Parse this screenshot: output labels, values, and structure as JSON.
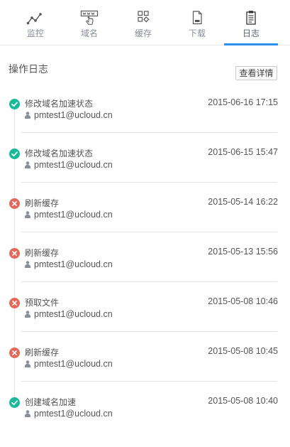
{
  "tabs": [
    {
      "key": "monitor",
      "label": "监控",
      "icon": "line-chart-icon"
    },
    {
      "key": "domain",
      "label": "域名",
      "icon": "www-domain-icon"
    },
    {
      "key": "cache",
      "label": "缓存",
      "icon": "cache-grid-icon"
    },
    {
      "key": "download",
      "label": "下载",
      "icon": "file-download-icon"
    },
    {
      "key": "log",
      "label": "日志",
      "icon": "clipboard-log-icon",
      "active": true
    }
  ],
  "log_section": {
    "title": "操作日志",
    "detail_button": "查看详情"
  },
  "colors": {
    "success": "#19b99a",
    "failure": "#e36a5a",
    "accent": "#2d8ff0"
  },
  "logs": [
    {
      "status": "success",
      "action": "修改域名加速状态",
      "time": "2015-06-16 17:15",
      "user": "pmtest1@ucloud.cn"
    },
    {
      "status": "success",
      "action": "修改域名加速状态",
      "time": "2015-06-15 15:47",
      "user": "pmtest1@ucloud.cn"
    },
    {
      "status": "failure",
      "action": "刷新缓存",
      "time": "2015-05-14 16:22",
      "user": "pmtest1@ucloud.cn"
    },
    {
      "status": "failure",
      "action": "刷新缓存",
      "time": "2015-05-13 15:56",
      "user": "pmtest1@ucloud.cn"
    },
    {
      "status": "failure",
      "action": "预取文件",
      "time": "2015-05-08 10:46",
      "user": "pmtest1@ucloud.cn"
    },
    {
      "status": "failure",
      "action": "刷新缓存",
      "time": "2015-05-08 10:45",
      "user": "pmtest1@ucloud.cn"
    },
    {
      "status": "success",
      "action": "创建域名加速",
      "time": "2015-05-08 10:40",
      "user": "pmtest1@ucloud.cn"
    }
  ]
}
